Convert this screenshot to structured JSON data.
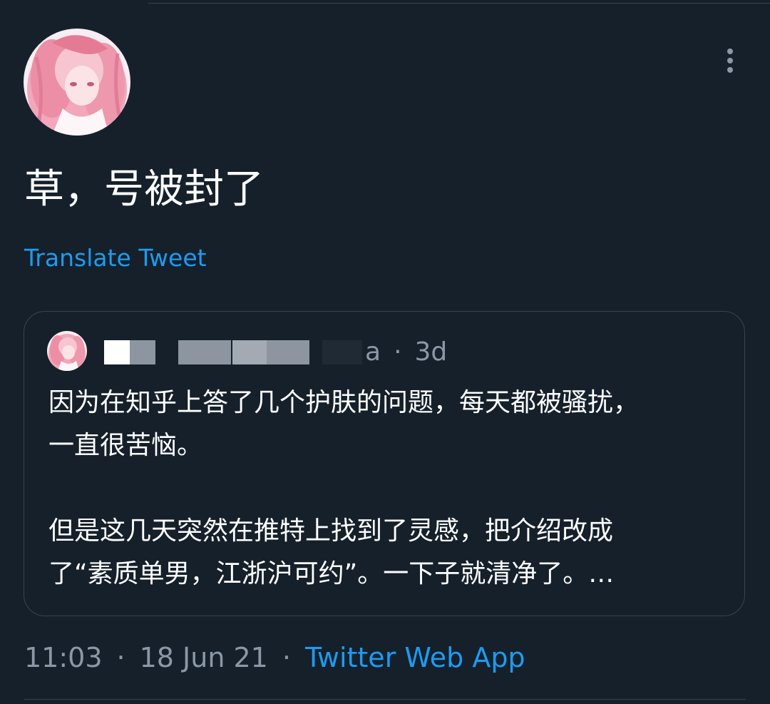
{
  "tweet": {
    "text": "草，号被封了",
    "translate_label": "Translate Tweet"
  },
  "quoted_tweet": {
    "handle_suffix": "a",
    "separator": "·",
    "age": "3d",
    "body_paragraphs": [
      "因为在知乎上答了几个护肤的问题，每天都被骚扰，\n一直很苦恼。",
      "但是这几天突然在推特上找到了灵感，把介绍改成\n了“素质单男，江浙沪可约”。一下子就清净了。…"
    ]
  },
  "footer": {
    "time": "11:03",
    "separator": "·",
    "date": "18 Jun 21",
    "source": "Twitter Web App"
  },
  "icons": {
    "more": "more-options-icon"
  },
  "colors": {
    "background": "#15202b",
    "link": "#1d9bf0",
    "secondary_text": "#8b98a5",
    "border": "#38444d"
  }
}
